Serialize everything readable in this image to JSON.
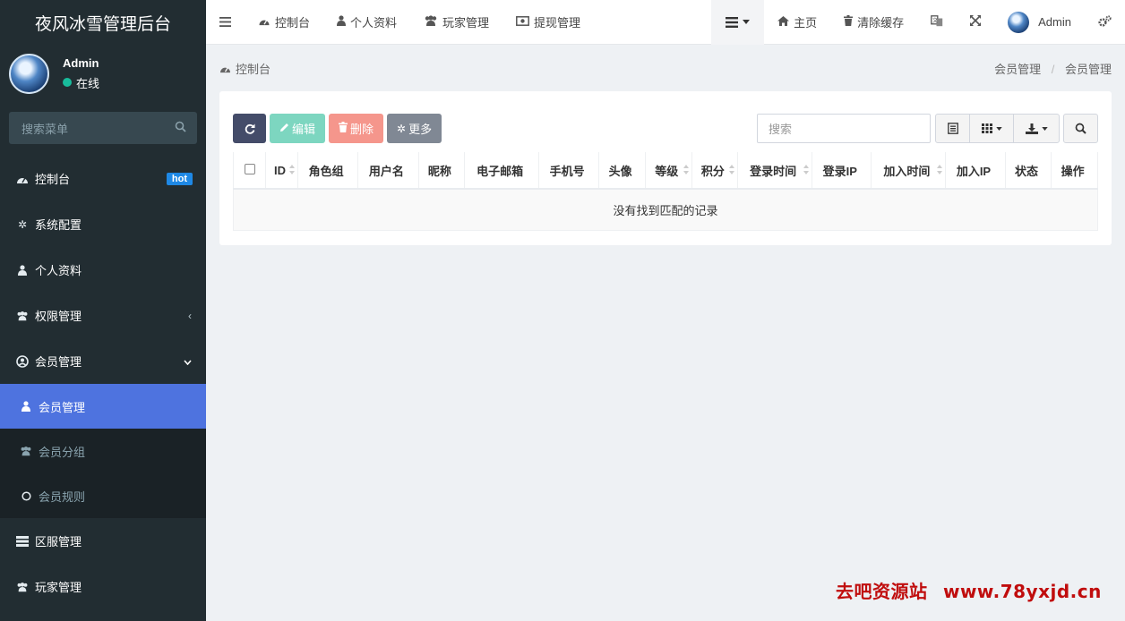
{
  "app": {
    "title": "夜风冰雪管理后台"
  },
  "user": {
    "name": "Admin",
    "status": "在线"
  },
  "sidebar": {
    "search_placeholder": "搜索菜单",
    "items": [
      {
        "label": "控制台",
        "icon": "dashboard-icon",
        "badge": "hot"
      },
      {
        "label": "系统配置",
        "icon": "gear-icon"
      },
      {
        "label": "个人资料",
        "icon": "user-icon"
      },
      {
        "label": "权限管理",
        "icon": "users-icon",
        "arrow": "‹"
      },
      {
        "label": "会员管理",
        "icon": "user-circle-icon",
        "arrow": "⌄"
      }
    ],
    "submenu": [
      {
        "label": "会员管理",
        "icon": "user-icon",
        "active": true
      },
      {
        "label": "会员分组",
        "icon": "users-icon"
      },
      {
        "label": "会员规则",
        "icon": "circle-icon"
      }
    ],
    "more": [
      {
        "label": "区服管理",
        "icon": "server-icon"
      },
      {
        "label": "玩家管理",
        "icon": "users-icon"
      }
    ]
  },
  "topbar": {
    "nav": [
      {
        "label": "控制台",
        "icon": "dashboard-icon"
      },
      {
        "label": "个人资料",
        "icon": "user-icon"
      },
      {
        "label": "玩家管理",
        "icon": "users-icon"
      },
      {
        "label": "提现管理",
        "icon": "money-icon"
      }
    ],
    "home_label": "主页",
    "clear_cache_label": "清除缓存",
    "admin_label": "Admin"
  },
  "breadcrumb": {
    "left": "控制台",
    "right": [
      "会员管理",
      "会员管理"
    ],
    "separator": "/"
  },
  "toolbar": {
    "edit_label": "编辑",
    "delete_label": "删除",
    "more_label": "更多",
    "search_placeholder": "搜索"
  },
  "table": {
    "columns": [
      {
        "label": "ID",
        "sortable": true
      },
      {
        "label": "角色组",
        "sortable": false
      },
      {
        "label": "用户名",
        "sortable": false
      },
      {
        "label": "昵称",
        "sortable": false
      },
      {
        "label": "电子邮箱",
        "sortable": false
      },
      {
        "label": "手机号",
        "sortable": false
      },
      {
        "label": "头像",
        "sortable": false
      },
      {
        "label": "等级",
        "sortable": true
      },
      {
        "label": "积分",
        "sortable": true
      },
      {
        "label": "登录时间",
        "sortable": true
      },
      {
        "label": "登录IP",
        "sortable": false
      },
      {
        "label": "加入时间",
        "sortable": true
      },
      {
        "label": "加入IP",
        "sortable": false
      },
      {
        "label": "状态",
        "sortable": false
      },
      {
        "label": "操作",
        "sortable": false
      }
    ],
    "empty_text": "没有找到匹配的记录"
  },
  "watermark": {
    "zh": "去吧资源站",
    "url": "www.78yxjd.cn"
  },
  "colors": {
    "sidebar_bg": "#222d32",
    "active_item": "#4e73df",
    "online": "#18bc9c",
    "hot_badge": "#1e88e5"
  }
}
